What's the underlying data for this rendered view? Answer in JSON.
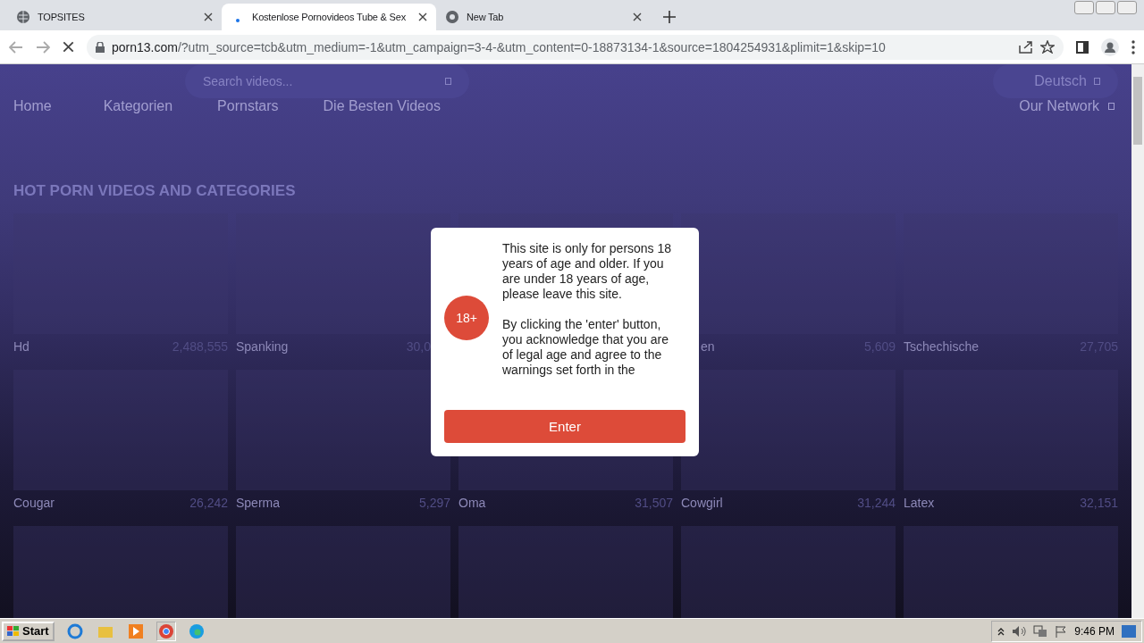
{
  "browser": {
    "tabs": [
      {
        "title": "TOPSITES",
        "kind": "site",
        "selected": false
      },
      {
        "title": "Kostenlose Pornovideos Tube & Sex",
        "kind": "loading",
        "selected": true
      },
      {
        "title": "New Tab",
        "kind": "newtab",
        "selected": false
      }
    ],
    "url_host": "porn13.com",
    "url_rest": "/?utm_source=tcb&utm_medium=-1&utm_campaign=3-4-&utm_content=0-18873134-1&source=1804254931&plimit=1&skip=10"
  },
  "site": {
    "search": {
      "placeholder": "Search videos..."
    },
    "language": "Deutsch",
    "nav": [
      "Home",
      "Kategorien",
      "Pornstars",
      "Die Besten Videos"
    ],
    "network": "Our Network",
    "heading": "HOT PORN VIDEOS AND CATEGORIES",
    "rows": [
      [
        {
          "kind": "full",
          "name": "Hd",
          "count": "2,488,555"
        },
        {
          "kind": "cut_count",
          "name": "Spanking",
          "count": "30,0"
        },
        {
          "kind": "hidden"
        },
        {
          "kind": "cut_name",
          "name": "en",
          "count": "5,609"
        },
        {
          "kind": "full",
          "name": "Tschechische",
          "count": "27,705"
        }
      ],
      [
        {
          "kind": "full",
          "name": "Cougar",
          "count": "26,242"
        },
        {
          "kind": "full",
          "name": "Sperma",
          "count": "5,297"
        },
        {
          "kind": "full",
          "name": "Oma",
          "count": "31,507"
        },
        {
          "kind": "full",
          "name": "Cowgirl",
          "count": "31,244"
        },
        {
          "kind": "full",
          "name": "Latex",
          "count": "32,151"
        }
      ],
      [
        {
          "kind": "hidden"
        },
        {
          "kind": "hidden"
        },
        {
          "kind": "hidden"
        },
        {
          "kind": "hidden"
        },
        {
          "kind": "hidden"
        }
      ]
    ]
  },
  "modal": {
    "badge": "18+",
    "paragraphs": [
      "This site is only for persons 18 years of age and older. If you are under 18 years of age, please leave this site.",
      "By clicking the 'enter' button, you acknowledge that you are of legal age and agree to the warnings set forth in the"
    ],
    "button": "Enter"
  },
  "taskbar": {
    "start": "Start",
    "clock": "9:46 PM"
  }
}
